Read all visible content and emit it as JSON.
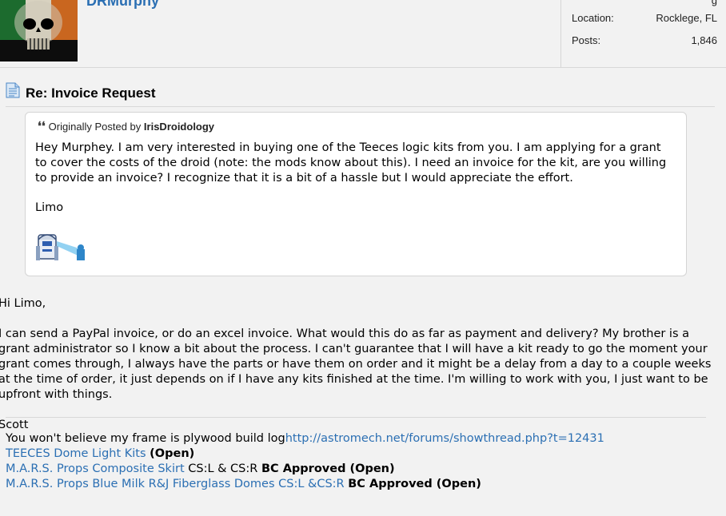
{
  "user": {
    "username": "DRMurphy",
    "stats": [
      {
        "label": "Location:",
        "value": "Rocklege, FL"
      },
      {
        "label": "Posts:",
        "value": "1,846"
      }
    ]
  },
  "post": {
    "title": "Re: Invoice Request",
    "quote": {
      "prefix": "Originally Posted by",
      "author": "IrisDroidology",
      "body": "Hey Murphey. I am very interested in buying one of the Teeces logic kits from you. I am applying for a grant to cover the costs of the droid (note: the mods know about this). I need an invoice for the kit, are you willing to provide an invoice? I recognize that it is a bit of a hassle but I would appreciate the effort.",
      "sign": "Limo"
    },
    "message": {
      "greeting": "Hi Limo,",
      "paragraph": "I can send a PayPal invoice, or do an excel invoice. What would this do as far as payment and delivery? My brother is a grant administrator so I know a bit about the process. I can't guarantee that I will have a kit ready to go the moment your grant comes through, I always have the parts or have them on order and it might be a delay from a day to a couple weeks at the time of order, it just depends on if I have any kits finished at the time. I'm willing to work with you, I just want to be upfront with things.",
      "sign_off": "Scott"
    }
  },
  "signature": {
    "line1_text": "You won't believe my frame is plywood build log",
    "line1_link": "http://astromech.net/forums/showthread.php?t=12431",
    "line2_link": "TEECES Dome Light Kits",
    "line2_status": "(Open)",
    "line3_link": "M.A.R.S. Props Composite Skirt",
    "line3_text": "CS:L & CS:R",
    "line3_status": "BC Approved (Open)",
    "line4_link": "M.A.R.S. Props Blue Milk R&J Fiberglass Domes CS:L &CS:R",
    "line4_status": "BC Approved (Open)"
  },
  "colors": {
    "link": "#2b6fb3",
    "background": "#f2f2f2"
  }
}
